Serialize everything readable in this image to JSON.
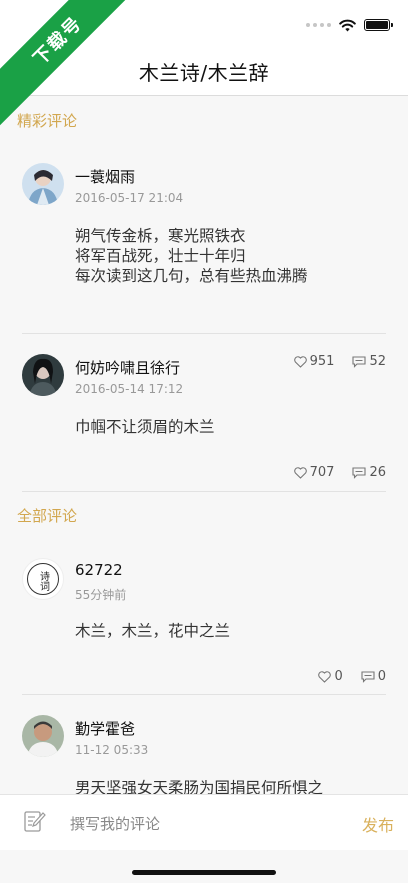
{
  "badge": {
    "text": "下载号"
  },
  "navbar": {
    "title": "木兰诗/木兰辞"
  },
  "featured": {
    "title": "精彩评论",
    "comments": [
      {
        "name": "一蓑烟雨",
        "time": "2016-05-17 21:04",
        "lines": [
          "朔气传金柝，寒光照铁衣",
          "将军百战死，壮士十年归",
          "每次读到这几句，总有些热血沸腾"
        ],
        "likes": "951",
        "replies": "52"
      },
      {
        "name": "何妨吟啸且徐行",
        "time": "2016-05-14 17:12",
        "lines": [
          "巾帼不让须眉的木兰"
        ],
        "likes": "707",
        "replies": "26"
      }
    ]
  },
  "all": {
    "title": "全部评论",
    "comments": [
      {
        "name": "62722",
        "time": "55分钟前",
        "lines": [
          "木兰，木兰，花中之兰"
        ],
        "likes": "0",
        "replies": "0",
        "avatar_text": "诗词"
      },
      {
        "name": "勤学霍爸",
        "time": "11-12 05:33",
        "lines": [
          "男天坚强女天柔肠为国捐民何所惧之"
        ]
      }
    ]
  },
  "composer": {
    "placeholder": "撰写我的评论",
    "publish_label": "发布"
  },
  "colors": {
    "accent": "#d2a74f",
    "badge": "#1aa146"
  },
  "icons": {
    "like": "heart-icon",
    "reply": "comment-icon",
    "edit": "edit-icon",
    "wifi": "wifi-icon",
    "battery": "battery-icon"
  }
}
